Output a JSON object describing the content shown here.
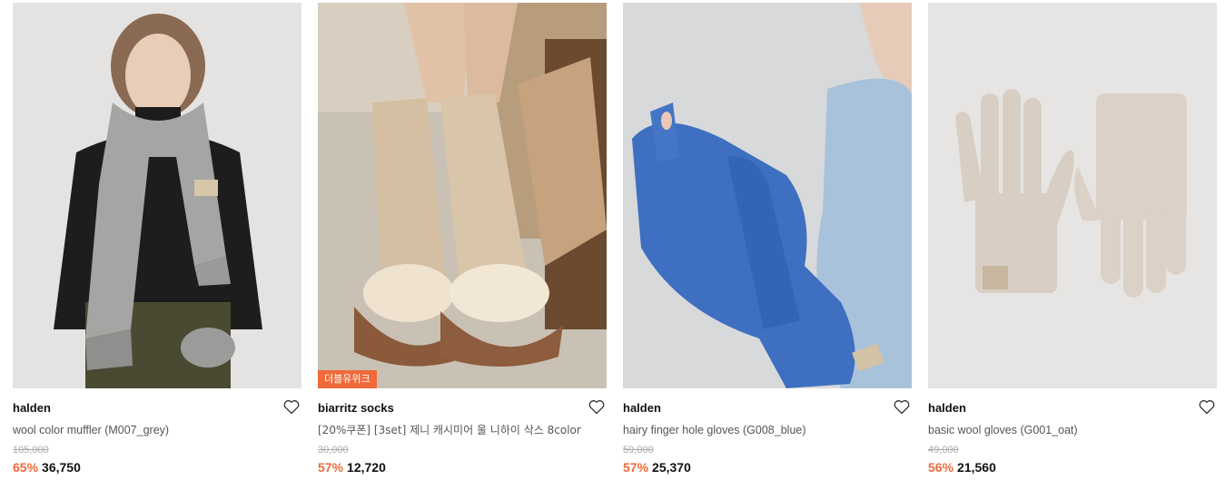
{
  "products": [
    {
      "brand": "halden",
      "name": "wool color muffler (M007_grey)",
      "original_price": "105,000",
      "discount": "65%",
      "price": "36,750",
      "badge": "",
      "image": "woman-grey-muffler-photo",
      "bg": "#e4e3e1"
    },
    {
      "brand": "biarritz socks",
      "name": "[20%쿠폰] [3set] 제니 캐시미어 울 니하이 삭스 8color",
      "original_price": "30,000",
      "discount": "57%",
      "price": "12,720",
      "badge": "더블유위크",
      "image": "knee-socks-boots-photo",
      "bg": "#c9c1b4"
    },
    {
      "brand": "halden",
      "name": "hairy finger hole gloves (G008_blue)",
      "original_price": "59,000",
      "discount": "57%",
      "price": "25,370",
      "badge": "",
      "image": "blue-gloves-photo",
      "bg": "#d7d9da"
    },
    {
      "brand": "halden",
      "name": "basic wool gloves (G001_oat)",
      "original_price": "49,000",
      "discount": "56%",
      "price": "21,560",
      "badge": "",
      "image": "oat-gloves-photo",
      "bg": "#e7e5e3"
    }
  ],
  "colors": {
    "accent": "#f06a3a",
    "text": "#111111",
    "muted": "#555555",
    "strike": "#aaaaaa"
  }
}
